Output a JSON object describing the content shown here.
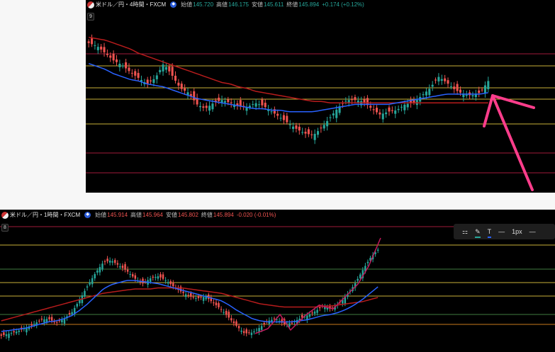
{
  "colors": {
    "bg": "#000000",
    "up": "#26a69a",
    "down": "#ef5350",
    "ma_short": "#2962ff",
    "ma_long": "#b71c1c",
    "hline_yellow": "#c9b037",
    "hline_red": "#a01a3a",
    "hline_green": "#3f7d3f",
    "hline_orange": "#c77a1b",
    "arrow": "#ff3d8b",
    "drawn_line": "#c2185b"
  },
  "top": {
    "symbol": "米ドル／円・4時間・FXCM",
    "o_label": "始値",
    "o": "145.720",
    "h_label": "高値",
    "h": "146.175",
    "l_label": "安値",
    "l": "145.611",
    "c_label": "終値",
    "c": "145.894",
    "change": "+0.174 (+0.12%)",
    "count": "9"
  },
  "bottom": {
    "symbol": "米ドル／円・1時間・FXCM",
    "o_label": "始値",
    "o": "145.914",
    "h_label": "高値",
    "h": "145.964",
    "l_label": "安値",
    "l": "145.802",
    "c_label": "終値",
    "c": "145.894",
    "change": "-0.020 (-0.01%)",
    "count": "8",
    "toolbar": {
      "icons": [
        "object-tree-icon",
        "pencil-icon",
        "text-icon",
        "line-style-icon",
        "more-icon"
      ],
      "text_icon": "T",
      "width_label": "1px"
    }
  },
  "chart_data": [
    {
      "type": "candlestick",
      "timeframe": "4H",
      "hlines": [
        "red",
        "yellow",
        "yellow",
        "yellow",
        "yellow",
        "red",
        "red"
      ],
      "series": [
        {
          "values": [
            0.86,
            0.84,
            0.79,
            0.74,
            0.71,
            0.66,
            0.62,
            0.58,
            0.62,
            0.72,
            0.64,
            0.55,
            0.52,
            0.44,
            0.41,
            0.45,
            0.47,
            0.45,
            0.43,
            0.42,
            0.45,
            0.43,
            0.39,
            0.35,
            0.31,
            0.27,
            0.24,
            0.23,
            0.28,
            0.35,
            0.42,
            0.47,
            0.47,
            0.46,
            0.41,
            0.37,
            0.39,
            0.4,
            0.44,
            0.45,
            0.5,
            0.55,
            0.63,
            0.59,
            0.54,
            0.51,
            0.5,
            0.52,
            0.6
          ]
        },
        {
          "values": [
            0.72,
            0.7,
            0.68,
            0.65,
            0.63,
            0.61,
            0.6,
            0.58,
            0.57,
            0.56,
            0.54,
            0.52,
            0.5,
            0.48,
            0.47,
            0.46,
            0.45,
            0.44,
            0.43,
            0.42,
            0.41,
            0.41,
            0.4,
            0.4,
            0.39,
            0.39,
            0.39,
            0.39,
            0.4,
            0.41,
            0.42,
            0.43,
            0.44,
            0.44,
            0.44,
            0.44,
            0.44,
            0.45,
            0.46,
            0.47,
            0.48,
            0.49,
            0.5,
            0.51,
            0.51,
            0.51,
            0.51,
            0.51,
            0.52
          ]
        },
        {
          "values": [
            0.9,
            0.89,
            0.88,
            0.86,
            0.84,
            0.82,
            0.79,
            0.77,
            0.75,
            0.73,
            0.71,
            0.69,
            0.67,
            0.65,
            0.63,
            0.61,
            0.59,
            0.58,
            0.56,
            0.55,
            0.53,
            0.52,
            0.51,
            0.5,
            0.49,
            0.48,
            0.47,
            0.46,
            0.46,
            0.45,
            0.45,
            0.45,
            0.45,
            0.45,
            0.45,
            0.45,
            0.45,
            0.45,
            0.45,
            0.45,
            0.45,
            0.45,
            0.45,
            0.45,
            0.45,
            0.45,
            0.45,
            0.45,
            0.45
          ]
        }
      ]
    },
    {
      "type": "candlestick",
      "timeframe": "1H",
      "hlines": [
        "red",
        "yellow",
        "green",
        "yellow",
        "yellow",
        "green",
        "orange"
      ],
      "series": [
        {
          "values": [
            0.08,
            0.1,
            0.12,
            0.15,
            0.18,
            0.23,
            0.24,
            0.2,
            0.24,
            0.3,
            0.42,
            0.55,
            0.67,
            0.77,
            0.79,
            0.74,
            0.69,
            0.62,
            0.57,
            0.62,
            0.64,
            0.6,
            0.54,
            0.49,
            0.45,
            0.43,
            0.45,
            0.39,
            0.33,
            0.25,
            0.17,
            0.1,
            0.11,
            0.16,
            0.22,
            0.24,
            0.19,
            0.2,
            0.24,
            0.27,
            0.31,
            0.36,
            0.33,
            0.38,
            0.46,
            0.56,
            0.69,
            0.81,
            0.89
          ]
        },
        {
          "values": [
            0.12,
            0.13,
            0.14,
            0.15,
            0.17,
            0.19,
            0.21,
            0.22,
            0.24,
            0.27,
            0.32,
            0.38,
            0.45,
            0.52,
            0.56,
            0.58,
            0.6,
            0.6,
            0.59,
            0.58,
            0.57,
            0.55,
            0.53,
            0.51,
            0.49,
            0.47,
            0.45,
            0.43,
            0.41,
            0.37,
            0.32,
            0.28,
            0.24,
            0.22,
            0.21,
            0.21,
            0.21,
            0.21,
            0.22,
            0.23,
            0.25,
            0.27,
            0.28,
            0.3,
            0.33,
            0.37,
            0.42,
            0.48,
            0.54
          ]
        },
        {
          "values": [
            0.22,
            0.24,
            0.26,
            0.28,
            0.3,
            0.32,
            0.34,
            0.36,
            0.38,
            0.4,
            0.42,
            0.44,
            0.46,
            0.48,
            0.49,
            0.5,
            0.51,
            0.52,
            0.52,
            0.52,
            0.53,
            0.53,
            0.53,
            0.53,
            0.52,
            0.51,
            0.5,
            0.49,
            0.48,
            0.46,
            0.44,
            0.42,
            0.4,
            0.38,
            0.37,
            0.36,
            0.35,
            0.35,
            0.35,
            0.35,
            0.35,
            0.36,
            0.36,
            0.37,
            0.38,
            0.39,
            0.4,
            0.42,
            0.44
          ]
        }
      ]
    }
  ]
}
